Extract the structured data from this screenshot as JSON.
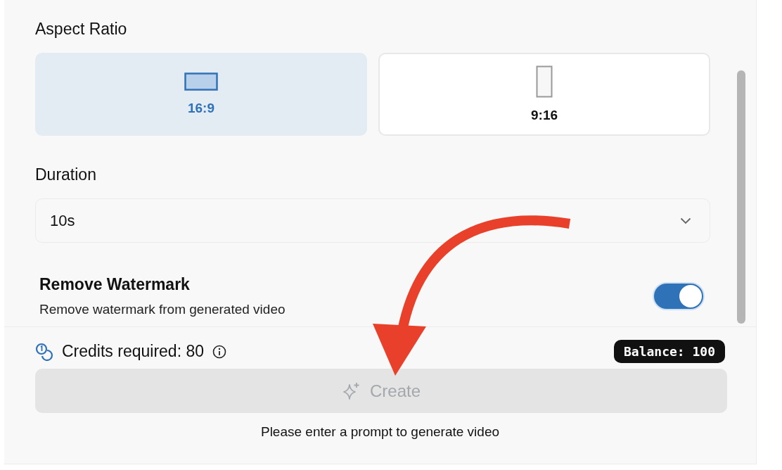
{
  "aspect_ratio": {
    "label": "Aspect Ratio",
    "options": [
      {
        "label": "16:9",
        "kind": "landscape",
        "selected": true
      },
      {
        "label": "9:16",
        "kind": "portrait",
        "selected": false
      }
    ]
  },
  "duration": {
    "label": "Duration",
    "value": "10s"
  },
  "remove_watermark": {
    "title": "Remove Watermark",
    "description": "Remove watermark from generated video",
    "on": true
  },
  "footer": {
    "credits": "Credits required: 80",
    "balance": "Balance: 100",
    "create_button": {
      "label": "Create",
      "disabled": true
    },
    "hint": "Please enter a prompt to generate video"
  }
}
